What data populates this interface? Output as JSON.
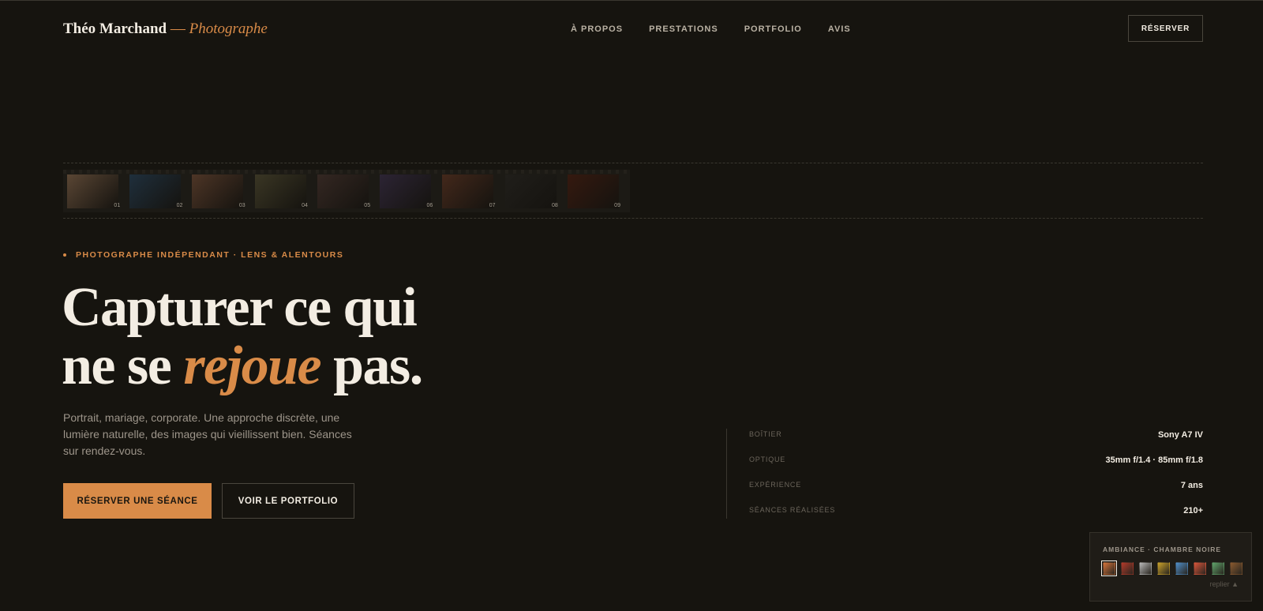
{
  "header": {
    "brand_name": "Théo Marchand",
    "brand_sep": " — ",
    "brand_role": "Photographe",
    "nav": [
      "À PROPOS",
      "PRESTATIONS",
      "PORTFOLIO",
      "AVIS"
    ],
    "reserve_label": "RÉSERVER"
  },
  "filmstrip": {
    "frames": [
      {
        "num": "01",
        "color": "#5a4634"
      },
      {
        "num": "02",
        "color": "#1f2f3c"
      },
      {
        "num": "03",
        "color": "#4d3526"
      },
      {
        "num": "04",
        "color": "#3a3624"
      },
      {
        "num": "05",
        "color": "#342722"
      },
      {
        "num": "06",
        "color": "#2c2434"
      },
      {
        "num": "07",
        "color": "#43281b"
      },
      {
        "num": "08",
        "color": "#201e1a"
      },
      {
        "num": "09",
        "color": "#35190f"
      }
    ]
  },
  "hero": {
    "eyebrow": "PHOTOGRAPHE INDÉPENDANT · LENS & ALENTOURS",
    "headline_line1": "Capturer ce qui",
    "headline_pre": "ne se ",
    "headline_accent": "rejoue",
    "headline_post": " pas.",
    "lede": "Portrait, mariage, corporate. Une approche discrète, une lumière naturelle, des images qui vieillissent bien. Séances sur rendez-vous.",
    "cta_primary": "RÉSERVER UNE SÉANCE",
    "cta_secondary": "VOIR LE PORTFOLIO"
  },
  "specs": [
    {
      "label": "BOÎTIER",
      "value": "Sony A7 IV"
    },
    {
      "label": "OPTIQUE",
      "value": "35mm f/1.4 · 85mm f/1.8"
    },
    {
      "label": "EXPÉRIENCE",
      "value": "7 ans"
    },
    {
      "label": "SÉANCES RÉALISÉES",
      "value": "210+"
    }
  ],
  "ambiance": {
    "title": "AMBIANCE · CHAMBRE NOIRE",
    "swatches": [
      "#d4733a",
      "#b33a2a",
      "#b8b8b8",
      "#c9a12a",
      "#4f8ec9",
      "#d9553a",
      "#5fa36a",
      "#8a5a2f"
    ],
    "active_index": 0,
    "collapse_label": "replier ▲"
  },
  "colors": {
    "background": "#16140f",
    "accent": "#d98b48",
    "text": "#f3ede3"
  }
}
